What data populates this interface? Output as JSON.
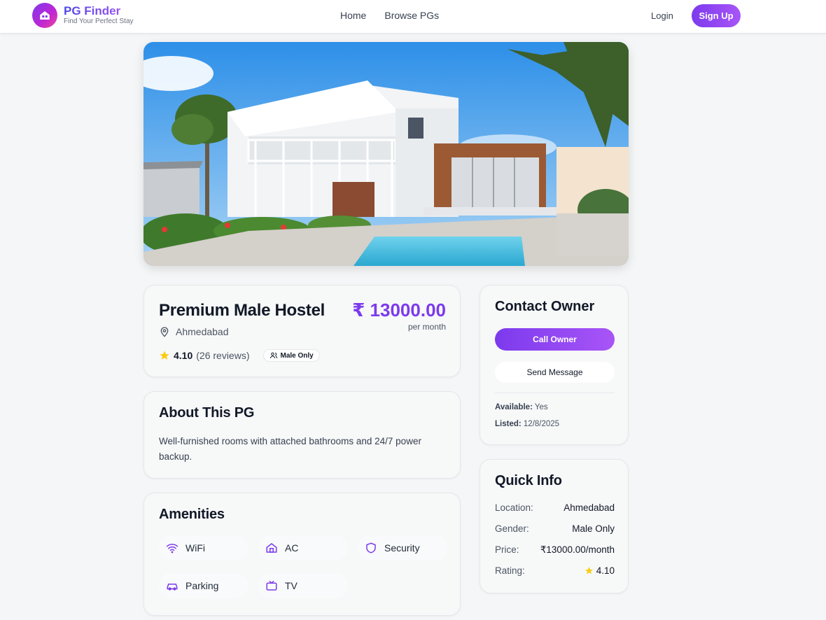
{
  "header": {
    "brand_name": "PG Finder",
    "brand_tagline": "Find Your Perfect Stay",
    "nav": [
      "Home",
      "Browse PGs"
    ],
    "login": "Login",
    "signup": "Sign Up"
  },
  "listing": {
    "title": "Premium Male Hostel",
    "price": "₹ 13000.00",
    "price_period": "per month",
    "location": "Ahmedabad",
    "rating": "4.10",
    "reviews": "(26 reviews)",
    "gender_badge": "Male Only"
  },
  "about": {
    "heading": "About This PG",
    "text": "Well-furnished rooms with attached bathrooms and 24/7 power backup."
  },
  "amenities": {
    "heading": "Amenities",
    "items": [
      {
        "label": "WiFi",
        "icon": "wifi-icon"
      },
      {
        "label": "AC",
        "icon": "home-icon"
      },
      {
        "label": "Security",
        "icon": "shield-icon"
      },
      {
        "label": "Parking",
        "icon": "car-icon"
      },
      {
        "label": "TV",
        "icon": "tv-icon"
      }
    ]
  },
  "contact": {
    "heading": "Contact Owner",
    "call_label": "Call Owner",
    "message_label": "Send Message",
    "available_label": "Available:",
    "available_value": "Yes",
    "listed_label": "Listed:",
    "listed_value": "12/8/2025"
  },
  "quick_info": {
    "heading": "Quick Info",
    "rows": [
      {
        "key": "Location:",
        "value": "Ahmedabad"
      },
      {
        "key": "Gender:",
        "value": "Male Only"
      },
      {
        "key": "Price:",
        "value": "₹13000.00/month"
      },
      {
        "key": "Rating:",
        "value": "4.10"
      }
    ]
  },
  "colors": {
    "accent": "#7c3aed",
    "accent_light": "#a855f7",
    "star": "#facc15"
  }
}
